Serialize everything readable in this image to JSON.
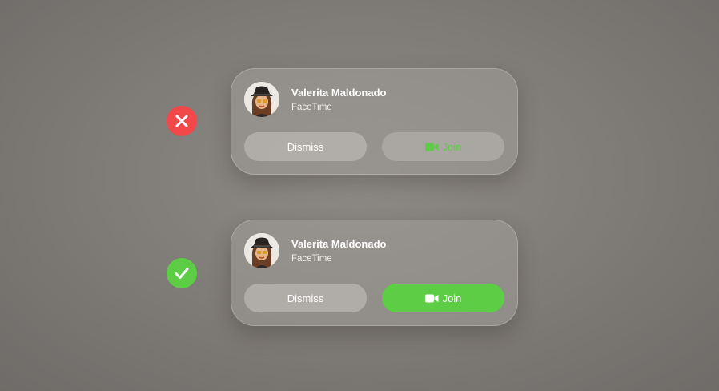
{
  "colors": {
    "bad_mark": "#f2484a",
    "good_mark": "#5ccd45",
    "join_green": "#5ccd45",
    "join_bad_bg": "#aaa6a2"
  },
  "examples": [
    {
      "status": "incorrect",
      "status_icon": "xmark-icon",
      "notification": {
        "name": "Valerita Maldonado",
        "app": "FaceTime",
        "dismiss_label": "Dismiss",
        "join_label": "Join",
        "join_icon": "video-camera-icon"
      }
    },
    {
      "status": "correct",
      "status_icon": "checkmark-icon",
      "notification": {
        "name": "Valerita Maldonado",
        "app": "FaceTime",
        "dismiss_label": "Dismiss",
        "join_label": "Join",
        "join_icon": "video-camera-icon"
      }
    }
  ]
}
